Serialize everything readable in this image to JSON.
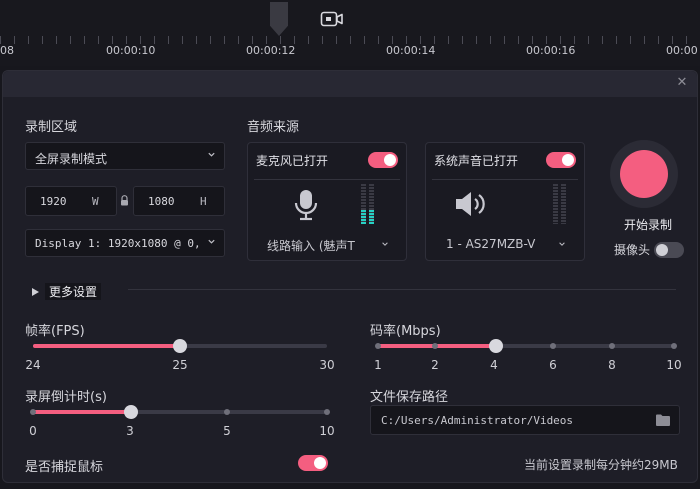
{
  "timeline": {
    "ticks": [
      "08",
      "00:00:10",
      "00:00:12",
      "00:00:14",
      "00:00:16",
      "00:00"
    ]
  },
  "dialog": {
    "close_icon": "✕",
    "record_area": {
      "label": "录制区域",
      "mode": "全屏录制模式",
      "width": "1920",
      "width_unit": "W",
      "height": "1080",
      "height_unit": "H",
      "display": "Display 1: 1920x1080 @ 0,"
    },
    "audio": {
      "label": "音频来源",
      "mic": {
        "title": "麦克风已打开",
        "device": "线路输入 (魅声T",
        "level": 0.35
      },
      "system": {
        "title": "系统声音已打开",
        "device": "1 - AS27MZB-V",
        "level": 0.0
      }
    },
    "record_button": {
      "label": "开始录制"
    },
    "camera": {
      "label": "摄像头"
    },
    "more_settings": {
      "label": "更多设置"
    },
    "fps": {
      "label": "帧率(FPS)",
      "min_label": "24",
      "mid_label": "25",
      "max_label": "30",
      "value": 25
    },
    "bitrate": {
      "label": "码率(Mbps)",
      "ticks": [
        "1",
        "2",
        "4",
        "6",
        "8",
        "10"
      ],
      "value": 4
    },
    "countdown": {
      "label": "录屏倒计时(s)",
      "ticks": [
        "0",
        "3",
        "5",
        "10"
      ],
      "value": 3
    },
    "save_path": {
      "label": "文件保存路径",
      "value": "C:/Users/Administrator/Videos"
    },
    "capture_mouse": {
      "label": "是否捕捉鼠标"
    },
    "estimate": {
      "text": "当前设置录制每分钟约29MB"
    }
  },
  "colors": {
    "accent": "#f45e80",
    "meter": "#27d1c4"
  }
}
